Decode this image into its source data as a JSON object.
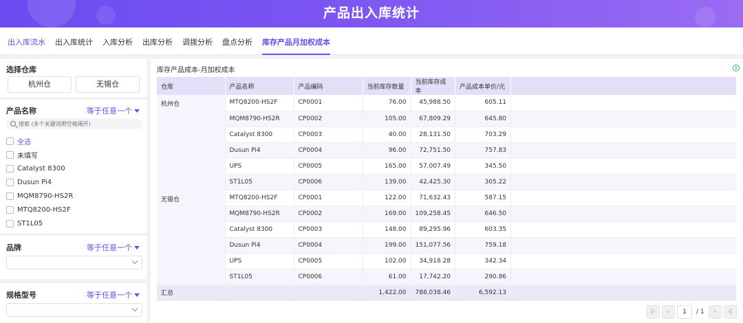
{
  "header": {
    "title": "产品出入库统计"
  },
  "tabs": [
    {
      "label": "出入库流水"
    },
    {
      "label": "出入库统计"
    },
    {
      "label": "入库分析"
    },
    {
      "label": "出库分析"
    },
    {
      "label": "调拨分析"
    },
    {
      "label": "盘点分析"
    },
    {
      "label": "库存产品月加权成本"
    }
  ],
  "active_tab": "库存产品月加权成本",
  "colors": {
    "accent": "#6a4cf0",
    "header_bg": "#e4def8",
    "info": "#3fb950"
  },
  "warehouse_filter": {
    "title": "选择仓库",
    "options": [
      "杭州仓",
      "无锡仓"
    ]
  },
  "product_filter": {
    "title": "产品名称",
    "operator": "等于任意一个",
    "search_placeholder": "搜索 (多个关键词用空格隔开)",
    "options": [
      "全选",
      "未填写",
      "Catalyst 8300",
      "Dusun Pi4",
      "MQM8790-HS2R",
      "MTQ8200-HS2F",
      "ST1L05"
    ]
  },
  "brand_filter": {
    "title": "品牌",
    "operator": "等于任意一个"
  },
  "model_filter": {
    "title": "规格型号",
    "operator": "等于任意一个"
  },
  "report": {
    "title": "库存产品成本-月加权成本",
    "columns": [
      "仓库",
      "产品名称",
      "产品编码",
      "当前库存数量",
      "当前库存成本",
      "产品成本单价/元"
    ],
    "groups": [
      {
        "warehouse": "杭州仓",
        "rows": [
          {
            "name": "MTQ8200-HS2F",
            "code": "CP0001",
            "qty": "76.00",
            "cost": "45,988.50",
            "unit": "605.11"
          },
          {
            "name": "MQM8790-HS2R",
            "code": "CP0002",
            "qty": "105.00",
            "cost": "67,809.29",
            "unit": "645.80"
          },
          {
            "name": "Catalyst 8300",
            "code": "CP0003",
            "qty": "40.00",
            "cost": "28,131.50",
            "unit": "703.29"
          },
          {
            "name": "Dusun Pi4",
            "code": "CP0004",
            "qty": "96.00",
            "cost": "72,751.50",
            "unit": "757.83"
          },
          {
            "name": "UPS",
            "code": "CP0005",
            "qty": "165.00",
            "cost": "57,007.49",
            "unit": "345.50"
          },
          {
            "name": "ST1L05",
            "code": "CP0006",
            "qty": "139.00",
            "cost": "42,425.30",
            "unit": "305.22"
          }
        ]
      },
      {
        "warehouse": "无锡仓",
        "rows": [
          {
            "name": "MTQ8200-HS2F",
            "code": "CP0001",
            "qty": "122.00",
            "cost": "71,632.43",
            "unit": "587.15"
          },
          {
            "name": "MQM8790-HS2R",
            "code": "CP0002",
            "qty": "169.00",
            "cost": "109,258.45",
            "unit": "646.50"
          },
          {
            "name": "Catalyst 8300",
            "code": "CP0003",
            "qty": "148.00",
            "cost": "89,295.96",
            "unit": "603.35"
          },
          {
            "name": "Dusun Pi4",
            "code": "CP0004",
            "qty": "199.00",
            "cost": "151,077.56",
            "unit": "759.18"
          },
          {
            "name": "UPS",
            "code": "CP0005",
            "qty": "102.00",
            "cost": "34,918.28",
            "unit": "342.34"
          },
          {
            "name": "ST1L05",
            "code": "CP0006",
            "qty": "61.00",
            "cost": "17,742.20",
            "unit": "290.86"
          }
        ]
      }
    ],
    "total": {
      "label": "汇总",
      "qty": "1,422.00",
      "cost": "788,038.46",
      "unit": "6,592.13"
    }
  },
  "pagination": {
    "current": "1",
    "total": "/ 1"
  }
}
